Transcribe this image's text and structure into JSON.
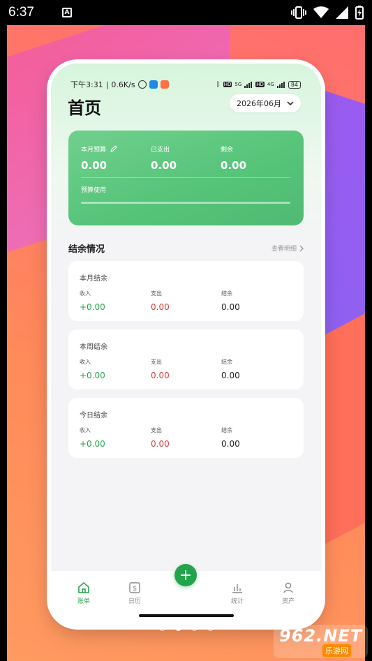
{
  "system": {
    "time": "6:37",
    "notif_letter": "A"
  },
  "phone_status": {
    "time_text": "下午3:31",
    "speed": "0.6K/s",
    "net1": "5G",
    "net2": "4G",
    "hd": "HD",
    "battery": "84"
  },
  "header": {
    "title": "首页",
    "month": "2026年06月"
  },
  "budget": {
    "monthly_budget_label": "本月预算",
    "monthly_budget_value": "0.00",
    "spent_label": "已支出",
    "spent_value": "0.00",
    "remaining_label": "剩余",
    "remaining_value": "0.00",
    "usage_label": "预算使用",
    "usage_fraction": 0
  },
  "balance": {
    "section_title": "结余情况",
    "view_detail": "查看明细",
    "cards": [
      {
        "title": "本月结余",
        "income_label": "收入",
        "income": "+0.00",
        "expense_label": "支出",
        "expense": "0.00",
        "balance_label": "结余",
        "balance": "0.00"
      },
      {
        "title": "本周结余",
        "income_label": "收入",
        "income": "+0.00",
        "expense_label": "支出",
        "expense": "0.00",
        "balance_label": "结余",
        "balance": "0.00"
      },
      {
        "title": "今日结余",
        "income_label": "收入",
        "income": "+0.00",
        "expense_label": "支出",
        "expense": "0.00",
        "balance_label": "结余",
        "balance": "0.00"
      }
    ]
  },
  "tabs": [
    {
      "label": "账单",
      "icon": "home-icon",
      "active": true
    },
    {
      "label": "日历",
      "icon": "calendar-dollar-icon",
      "active": false
    },
    {
      "label": "",
      "icon": "plus-icon",
      "active": false
    },
    {
      "label": "统计",
      "icon": "bar-chart-icon",
      "active": false
    },
    {
      "label": "资产",
      "icon": "user-icon",
      "active": false
    }
  ],
  "colors": {
    "accent": "#2aa34f",
    "income": "#2aa34f",
    "expense": "#d63d3d"
  },
  "watermark": {
    "big": "962.NET",
    "small": "乐游网"
  }
}
